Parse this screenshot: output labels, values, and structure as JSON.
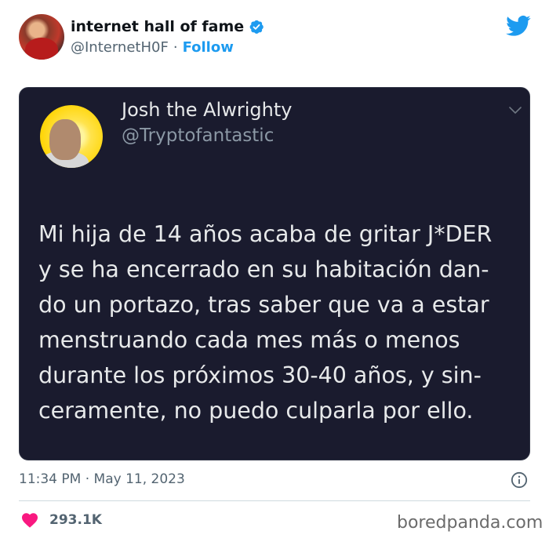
{
  "author": {
    "name": "internet hall of fame",
    "handle": "@InternetH0F",
    "follow_label": "Follow",
    "separator": "·",
    "verified": true
  },
  "quoted_tweet": {
    "name": "Josh the Alwrighty",
    "handle": "@Tryptofantastic",
    "text": "Mi hija de 14 años acaba de gritar J*DER\ny se ha encerrado en su habitación dan-\ndo un portazo, tras saber que va a estar\nmenstruando cada mes más o menos\ndurante los próximos 30-40 años, y sin-\nceramente, no puedo culparla por ello."
  },
  "meta": {
    "timestamp": "11:34 PM · May 11, 2023",
    "likes": "293.1K"
  },
  "watermark": "boredpanda.com",
  "icons": {
    "verified": "verified-badge-icon",
    "brand": "twitter-bird-icon",
    "menu": "chevron-down-icon",
    "info": "info-icon",
    "like": "heart-icon"
  },
  "colors": {
    "accent": "#1d9bf0",
    "like": "#f91880",
    "card_bg": "#1a1b2e",
    "muted": "#536471"
  }
}
